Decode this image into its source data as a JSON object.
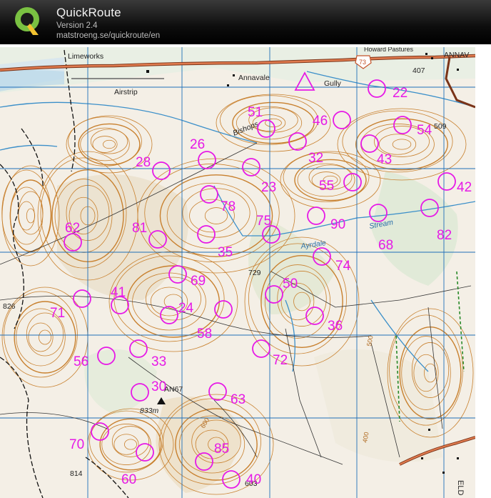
{
  "app": {
    "title": "QuickRoute",
    "version": "Version 2.4",
    "url": "matstroeng.se/quickroute/en"
  },
  "map": {
    "place_labels": {
      "limeworks": "Limeworks",
      "airstrip": "Airstrip",
      "annavale": "Annavale",
      "annav": "ANNAV",
      "gully": "Gully",
      "bishops": "Bishops",
      "ayrdale": "Ayrdale",
      "stream": "Stream",
      "howard_pastures": "Howard Pastures",
      "road_73": "73",
      "spot_407": "407",
      "spot_509": "509",
      "spot_729": "729",
      "spot_826": "826",
      "trig": "AN67",
      "trig_height": "833m",
      "spot_814": "814",
      "spot_603": "603",
      "contour_600": "600",
      "contour_500": "500",
      "contour_400": "400",
      "eld": "ELD"
    },
    "colors": {
      "control": "#e619e6",
      "contour": "#c8802e",
      "grid": "#1f6fb8",
      "road": "#c4542a",
      "water": "#3b8fc9"
    },
    "controls": [
      {
        "number": "22"
      },
      {
        "number": "46"
      },
      {
        "number": "54"
      },
      {
        "number": "51"
      },
      {
        "number": "32"
      },
      {
        "number": "43"
      },
      {
        "number": "26"
      },
      {
        "number": "28"
      },
      {
        "number": "23"
      },
      {
        "number": "55"
      },
      {
        "number": "42"
      },
      {
        "number": "78"
      },
      {
        "number": "75"
      },
      {
        "number": "90"
      },
      {
        "number": "68"
      },
      {
        "number": "82"
      },
      {
        "number": "62"
      },
      {
        "number": "81"
      },
      {
        "number": "35"
      },
      {
        "number": "74"
      },
      {
        "number": "69"
      },
      {
        "number": "50"
      },
      {
        "number": "41"
      },
      {
        "number": "71"
      },
      {
        "number": "24"
      },
      {
        "number": "58"
      },
      {
        "number": "36"
      },
      {
        "number": "56"
      },
      {
        "number": "33"
      },
      {
        "number": "72"
      },
      {
        "number": "30"
      },
      {
        "number": "63"
      },
      {
        "number": "70"
      },
      {
        "number": "85"
      },
      {
        "number": "60"
      },
      {
        "number": "40"
      }
    ],
    "start": "start-triangle"
  }
}
